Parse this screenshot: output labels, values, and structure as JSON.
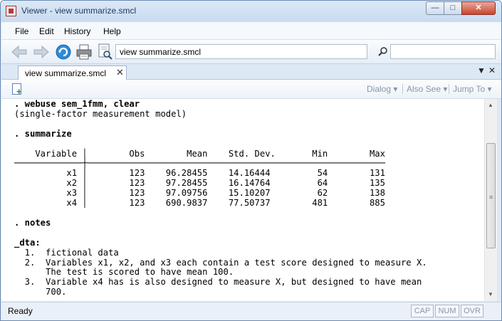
{
  "window": {
    "title": "Viewer - view summarize.smcl",
    "minimize": "—",
    "maximize": "□",
    "close": "✕"
  },
  "menu": {
    "items": [
      "File",
      "Edit",
      "History",
      "Help"
    ]
  },
  "toolbar": {
    "address": "view summarize.smcl",
    "find_placeholder": ""
  },
  "tabs": {
    "active": "view summarize.smcl",
    "close": "✕",
    "nav_down": "▼",
    "nav_close": "✕"
  },
  "commandbar": {
    "dialog": "Dialog ▾",
    "also_see": "Also See ▾",
    "jump_to": "Jump To ▾"
  },
  "results": {
    "lines": [
      {
        "bold": true,
        "text": ". webuse sem_1fmm, clear"
      },
      {
        "bold": false,
        "text": "(single-factor measurement model)"
      },
      {
        "bold": false,
        "text": ""
      },
      {
        "bold": true,
        "text": ". summarize"
      },
      {
        "bold": false,
        "text": ""
      },
      {
        "bold": false,
        "text": "    Variable │        Obs        Mean    Std. Dev.       Min        Max"
      },
      {
        "bold": false,
        "text": "─────────────┼─────────────────────────────────────────────────────────"
      },
      {
        "bold": false,
        "text": "          x1 │        123    96.28455    14.16444         54        131"
      },
      {
        "bold": false,
        "text": "          x2 │        123    97.28455    16.14764         64        135"
      },
      {
        "bold": false,
        "text": "          x3 │        123    97.09756    15.10207         62        138"
      },
      {
        "bold": false,
        "text": "          x4 │        123    690.9837    77.50737        481        885"
      },
      {
        "bold": false,
        "text": ""
      },
      {
        "bold": true,
        "text": ". notes"
      },
      {
        "bold": false,
        "text": ""
      },
      {
        "bold": true,
        "text": "_dta:"
      },
      {
        "bold": false,
        "text": "  1.  fictional data"
      },
      {
        "bold": false,
        "text": "  2.  Variables x1, x2, and x3 each contain a test score designed to measure X."
      },
      {
        "bold": false,
        "text": "      The test is scored to have mean 100."
      },
      {
        "bold": false,
        "text": "  3.  Variable x4 has is also designed to measure X, but designed to have mean"
      },
      {
        "bold": false,
        "text": "      700."
      }
    ]
  },
  "scrollbar": {
    "up": "▲",
    "down": "▼",
    "grip": "≡"
  },
  "status": {
    "text": "Ready",
    "cap": "CAP",
    "num": "NUM",
    "ovr": "OVR"
  },
  "icons": [
    "back-arrow-icon",
    "forward-arrow-icon",
    "refresh-icon",
    "print-icon",
    "search-document-icon",
    "find-icon",
    "new-viewer-icon"
  ]
}
